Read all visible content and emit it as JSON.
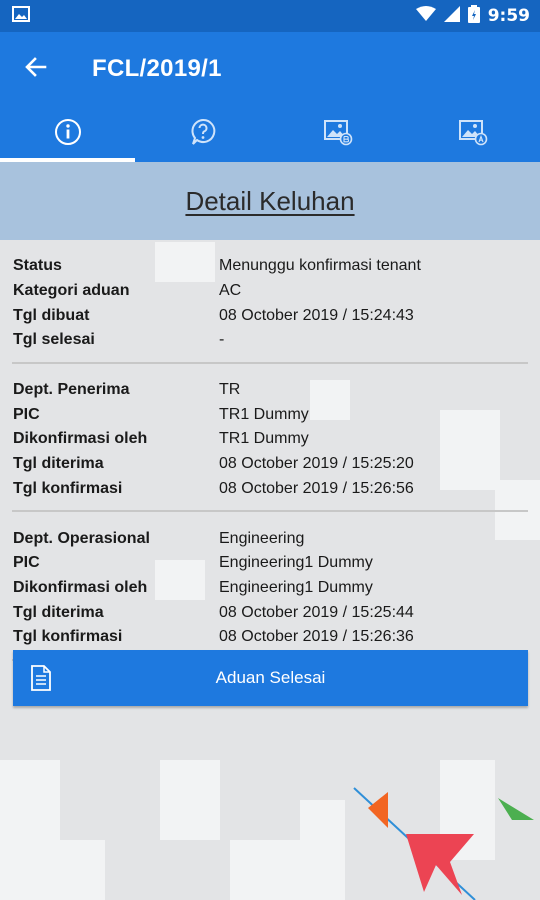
{
  "status_bar": {
    "time": "9:59",
    "icons": [
      "image-icon",
      "wifi-icon",
      "signal-icon",
      "battery-icon"
    ]
  },
  "app_bar": {
    "title": "FCL/2019/1",
    "back_icon": "arrow-left-icon"
  },
  "tabs": [
    {
      "icon": "info-circle-icon",
      "active": true
    },
    {
      "icon": "question-bubble-icon",
      "active": false
    },
    {
      "icon": "image-badge-icon",
      "active": false
    },
    {
      "icon": "image-badge-icon",
      "active": false
    }
  ],
  "page_header": "Detail Keluhan",
  "sections": [
    {
      "rows": [
        {
          "label": "Status",
          "value": "Menunggu konfirmasi tenant"
        },
        {
          "label": "Kategori aduan",
          "value": "AC"
        },
        {
          "label": "Tgl dibuat",
          "value": "08 October 2019 / 15:24:43"
        },
        {
          "label": "Tgl selesai",
          "value": "-"
        }
      ]
    },
    {
      "rows": [
        {
          "label": "Dept. Penerima",
          "value": "TR"
        },
        {
          "label": "PIC",
          "value": "TR1 Dummy"
        },
        {
          "label": "Dikonfirmasi oleh",
          "value": "TR1 Dummy"
        },
        {
          "label": "Tgl diterima",
          "value": "08 October 2019 / 15:25:20"
        },
        {
          "label": "Tgl konfirmasi",
          "value": "08 October 2019 / 15:26:56"
        }
      ]
    },
    {
      "rows": [
        {
          "label": "Dept. Operasional",
          "value": "Engineering"
        },
        {
          "label": "PIC",
          "value": "Engineering1 Dummy"
        },
        {
          "label": "Dikonfirmasi oleh",
          "value": "Engineering1 Dummy"
        },
        {
          "label": "Tgl diterima",
          "value": "08 October 2019 / 15:25:44"
        },
        {
          "label": "Tgl konfirmasi",
          "value": "08 October 2019 / 15:26:36"
        }
      ]
    }
  ],
  "action_button": {
    "label": "Aduan Selesai",
    "icon": "document-list-icon"
  },
  "colors": {
    "primary": "#1e79df",
    "status_bar": "#1565c0",
    "header_band": "#a8c2dd",
    "logo_orange": "#f26522",
    "logo_red": "#ec4453",
    "logo_green": "#4caf50",
    "logo_line": "#2f8fd8"
  }
}
